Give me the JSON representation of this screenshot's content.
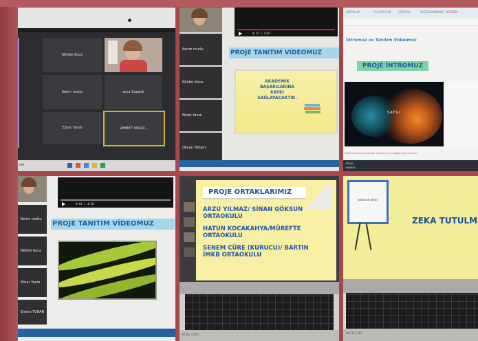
{
  "tile1": {
    "participants": [
      "Nilüfer Koca",
      "Kerim mutlu",
      "arya Sapank",
      "Ebrar Yandı",
      "AHMET YASUR..."
    ],
    "taskbar_label": "wo"
  },
  "tile2": {
    "participants": [
      "Kerim mutlu",
      "Nilüfer Koca",
      "Ebrar Yandı",
      "Okcan Yeltam"
    ],
    "video_time": "0:35 / 4:07",
    "headline": "PROJE TANITIM VIDEOMUZ",
    "slide_lines": [
      "AKADEMİK",
      "BAŞARILARINA",
      "KATKI",
      "SAĞLAYACAKTIR."
    ]
  },
  "tile3": {
    "nav_tabs": [
      "ORTAKLAR",
      "FAALİYETLER",
      "ÇIKTILAR",
      "DEĞERLENDİRME"
    ],
    "nav_extra": "İLETİŞİM",
    "section_title": "İntromuz ve Tanıtım Videomuz",
    "headline": "PROJE İNTROMUZ",
    "intro_small": "SAYGI",
    "caption": "Proje İntromuz ve tanıtım videomuz için bağlantıya tıklayınız.",
    "footer_left": "PROJE",
    "footer_sub": "KAMERA"
  },
  "tile4": {
    "participants": [
      "Kerim mutlu",
      "Nilüfer Koca",
      "Ebrar Yandı",
      "Emine TURAN"
    ],
    "video_time": "0:01 / 4:26",
    "headline": "PROJE TANITIM VİDEOMUZ"
  },
  "tile5": {
    "title": "PROJE ORTAKLARIMIZ",
    "partners": [
      [
        "ARZU YILMAZ/ SİNAN GÖKSUN",
        "ORTAOKULU"
      ],
      [
        "HATUN KOCAKAHYA/MÜREFTE",
        "ORTAOKULU"
      ],
      [
        "SENEM CÜRE (KURUCU)/ BARTIN",
        "İMKB ORTAOKULU"
      ]
    ],
    "footer": "NOTE 3 PRO"
  },
  "tile6": {
    "board_label": "MÜNEVER KEMET",
    "headline": "ZEKA TUTULMA",
    "footer": "NOTE 3 PRO"
  },
  "colors": {
    "frame": "#a8454d",
    "headline_blue": "#1c5f9e",
    "headline_bg": "#a6d6ea",
    "intro_bg": "#7fd2a8"
  }
}
